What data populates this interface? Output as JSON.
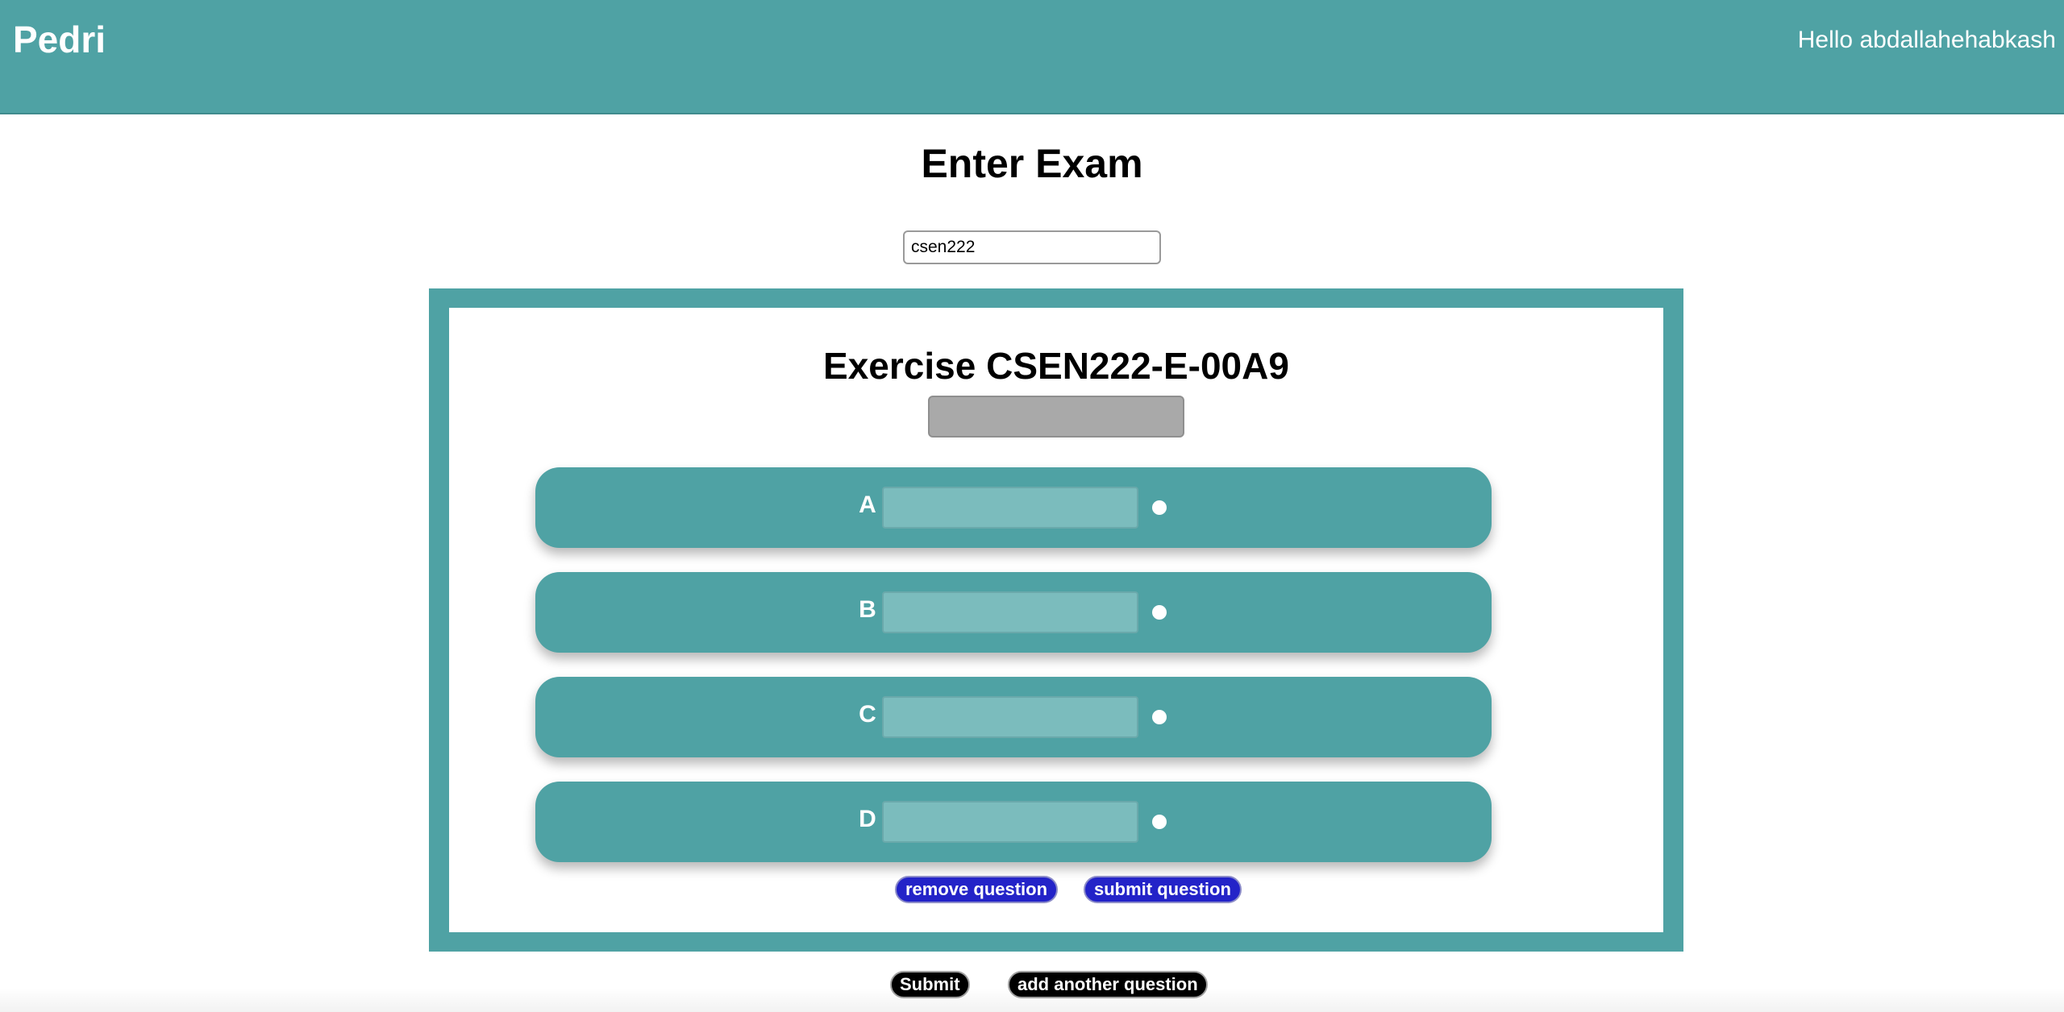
{
  "header": {
    "brand": "Pedri",
    "greeting": "Hello abdallahehabkash",
    "background_color": "#4fa2a4"
  },
  "page_title": "Enter Exam",
  "exam_field": {
    "value": "csen222"
  },
  "exercise": {
    "title": "Exercise CSEN222-E-00A9",
    "question_value": "",
    "options": [
      {
        "letter": "A",
        "value": ""
      },
      {
        "letter": "B",
        "value": ""
      },
      {
        "letter": "C",
        "value": ""
      },
      {
        "letter": "D",
        "value": ""
      }
    ],
    "remove_label": "remove question",
    "submit_question_label": "submit question"
  },
  "footer_actions": {
    "submit_label": "Submit",
    "add_question_label": "add another question"
  },
  "colors": {
    "accent": "#4fa2a4",
    "question_button": "#2323c8",
    "footer_button": "#000000"
  }
}
